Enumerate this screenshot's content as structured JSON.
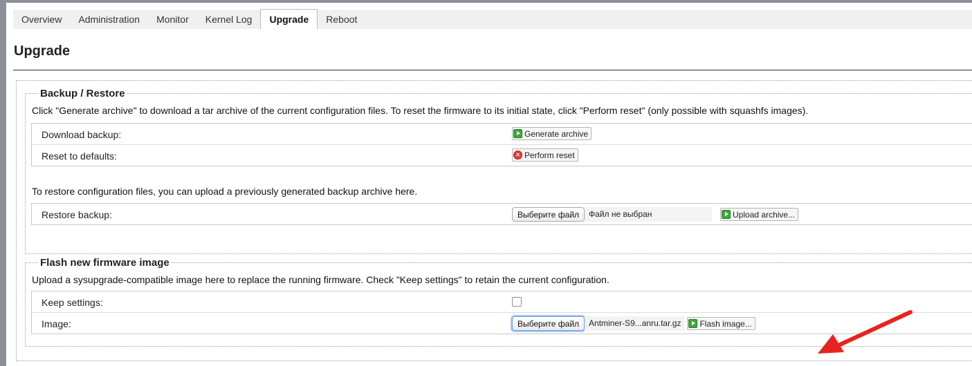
{
  "tabs": [
    "Overview",
    "Administration",
    "Monitor",
    "Kernel Log",
    "Upgrade",
    "Reboot"
  ],
  "active_tab": "Upgrade",
  "page_title": "Upgrade",
  "backup": {
    "legend": "Backup / Restore",
    "description": "Click \"Generate archive\" to download a tar archive of the current configuration files. To reset the firmware to its initial state, click \"Perform reset\" (only possible with squashfs images).",
    "download_label": "Download backup:",
    "generate_button": "Generate archive",
    "reset_label": "Reset to defaults:",
    "reset_button": "Perform reset",
    "restore_description": "To restore configuration files, you can upload a previously generated backup archive here.",
    "restore_label": "Restore backup:",
    "choose_file_button": "Выберите файл",
    "no_file_text": "Файл не выбран",
    "upload_button": "Upload archive..."
  },
  "flash": {
    "legend": "Flash new firmware image",
    "description": "Upload a sysupgrade-compatible image here to replace the running firmware. Check \"Keep settings\" to retain the current configuration.",
    "keep_label": "Keep settings:",
    "keep_checked": false,
    "image_label": "Image:",
    "choose_file_button": "Выберите файл",
    "file_name": "Antminer-S9...anru.tar.gz",
    "flash_button": "Flash image..."
  },
  "colors": {
    "accent_green": "#3fa83a",
    "reset_red": "#e0413a",
    "annotation_arrow": "#e8231e",
    "frame_gray": "#8c8e99"
  }
}
